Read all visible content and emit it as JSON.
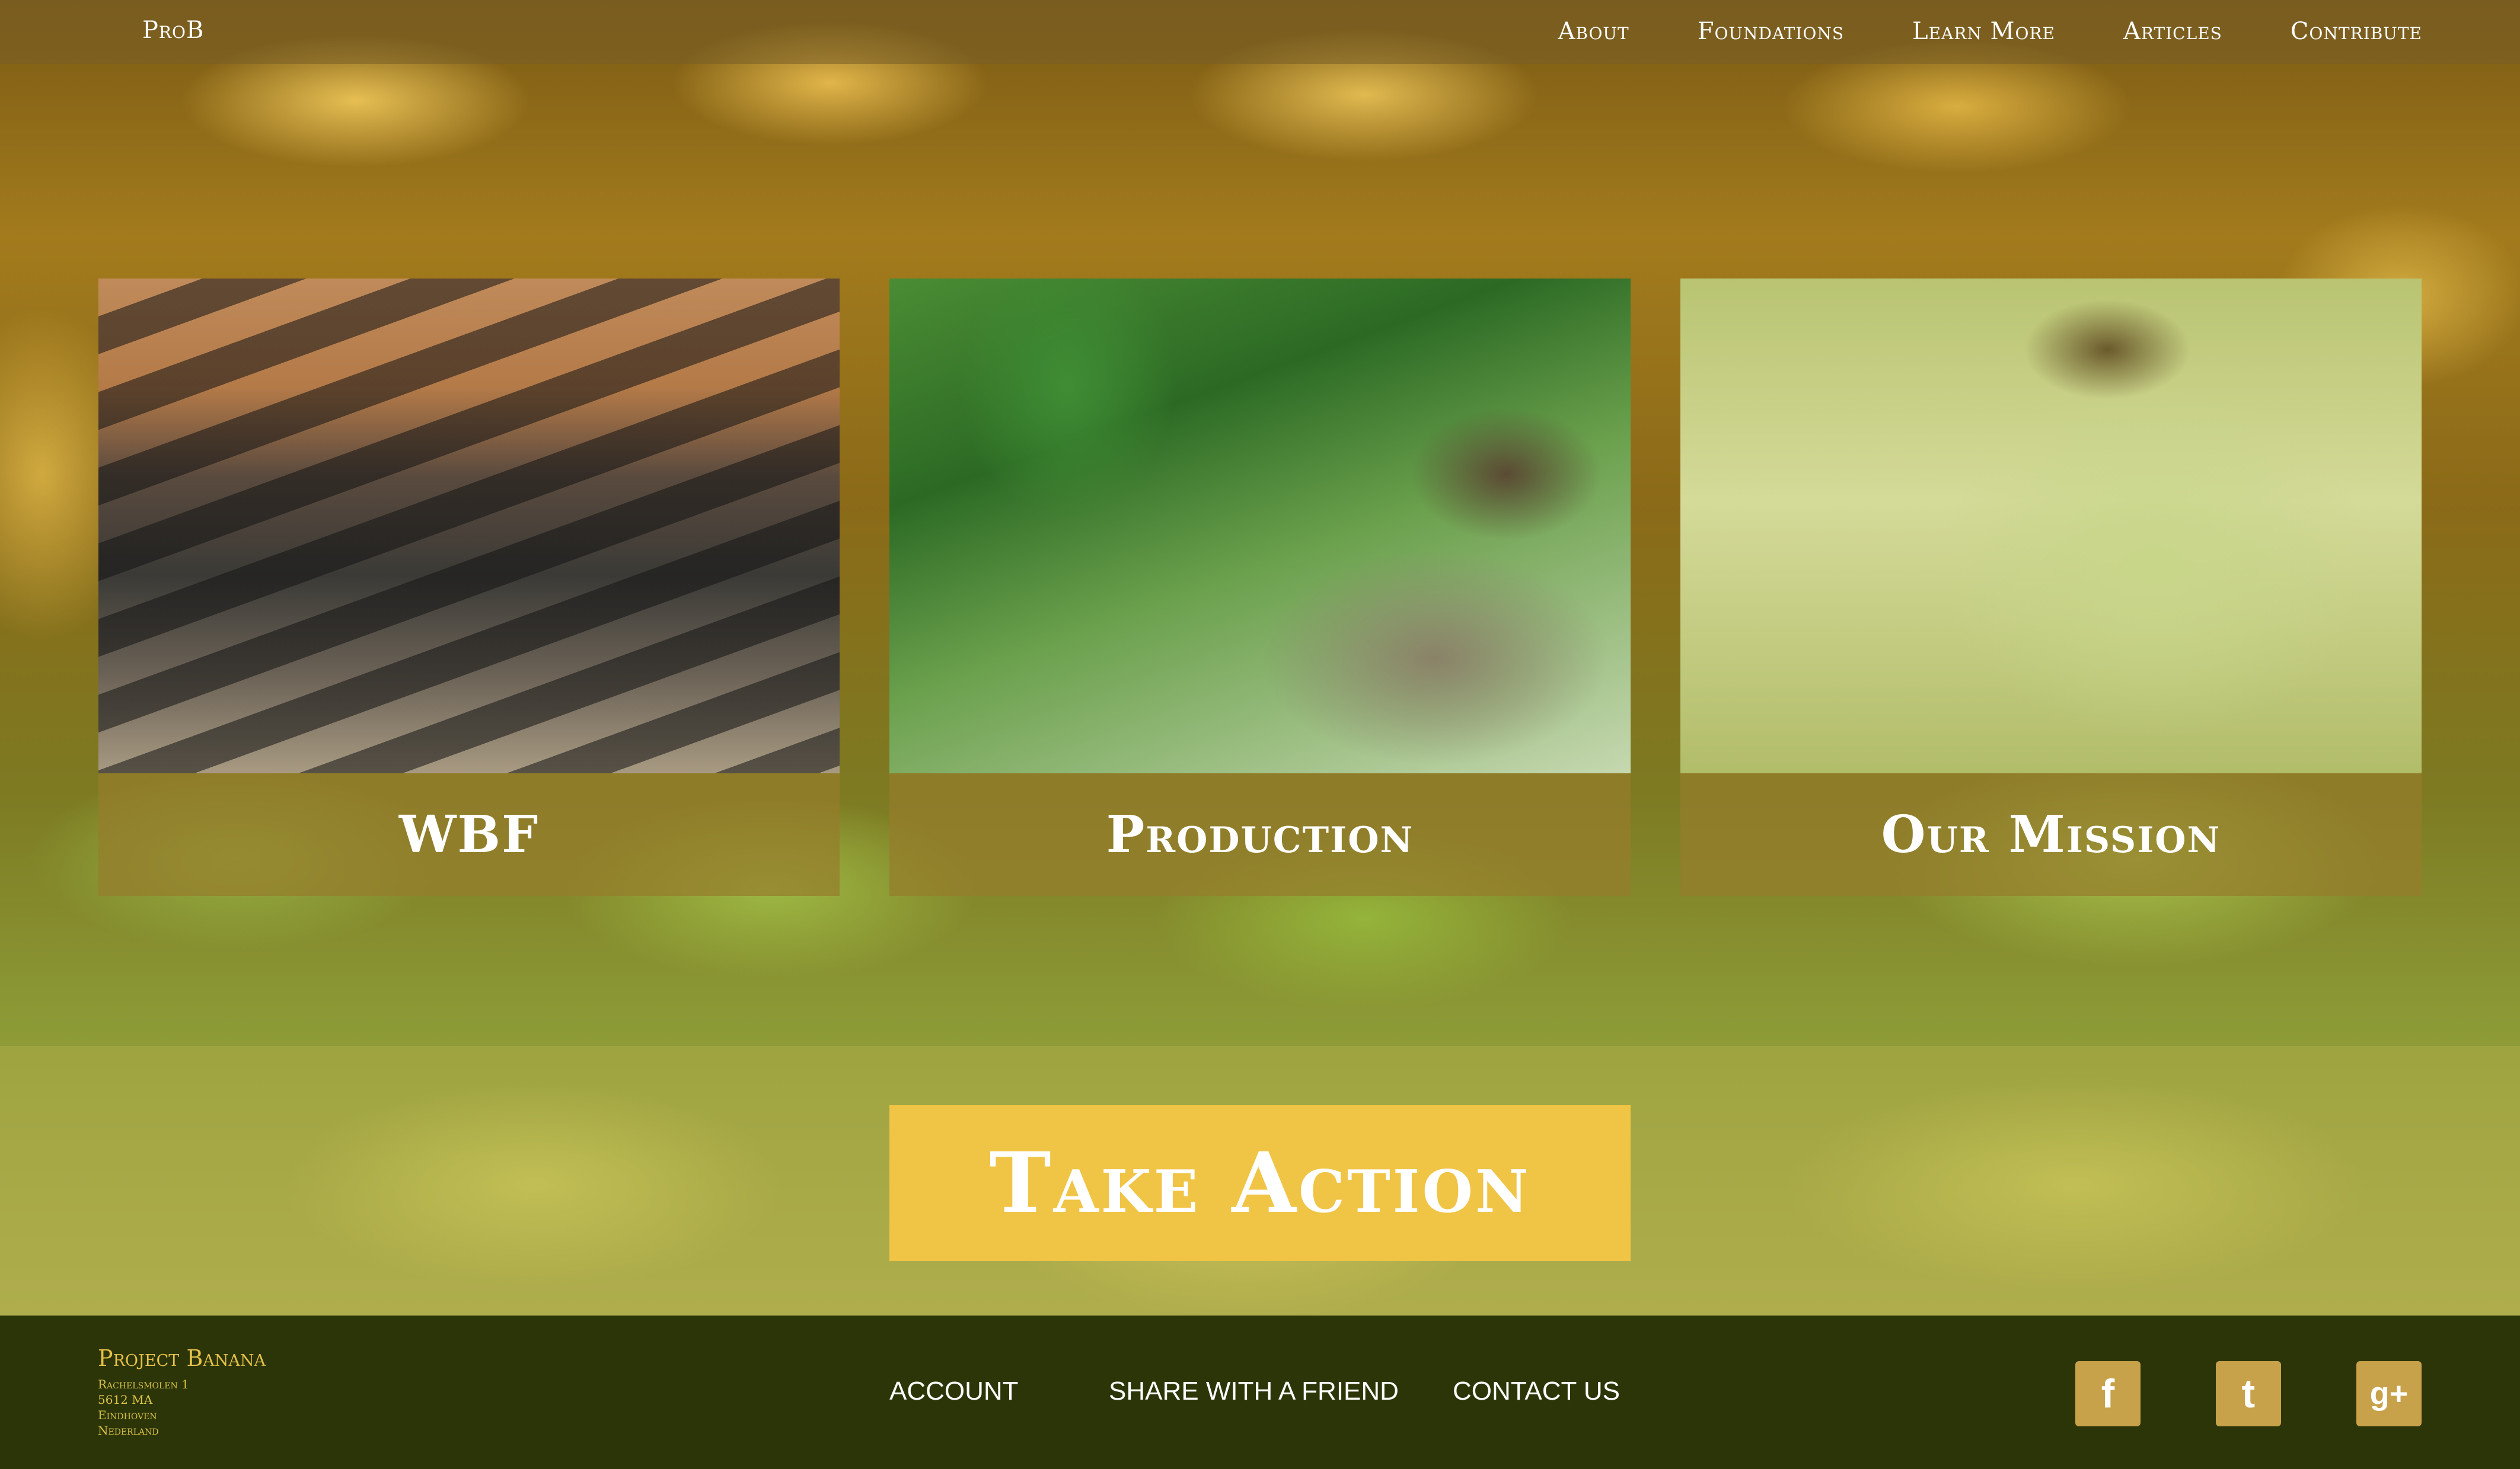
{
  "nav": {
    "brand": "ProB",
    "items": [
      {
        "label": "About"
      },
      {
        "label": "Foundations"
      },
      {
        "label": "Learn More"
      },
      {
        "label": "Articles"
      },
      {
        "label": "Contribute"
      }
    ]
  },
  "cards": [
    {
      "title": "WBF"
    },
    {
      "title": "Production"
    },
    {
      "title": "Our Mission"
    }
  ],
  "cta": {
    "label": "Take Action"
  },
  "footer": {
    "brand": "Project Banana",
    "address": [
      "Rachelsmolen 1",
      "5612 MA",
      "Eindhoven",
      "Nederland"
    ],
    "links": [
      {
        "label": "ACCOUNT"
      },
      {
        "label": "SHARE WITH A FRIEND"
      },
      {
        "label": "CONTACT US"
      }
    ],
    "social": [
      {
        "icon": "facebook-icon",
        "glyph": "f"
      },
      {
        "icon": "twitter-icon",
        "glyph": "t"
      },
      {
        "icon": "google-plus-icon",
        "glyph": "g+"
      }
    ]
  },
  "colors": {
    "accent": "#f0c445",
    "footer_bg": "#2c3507",
    "footer_brand": "#e7c14a"
  }
}
